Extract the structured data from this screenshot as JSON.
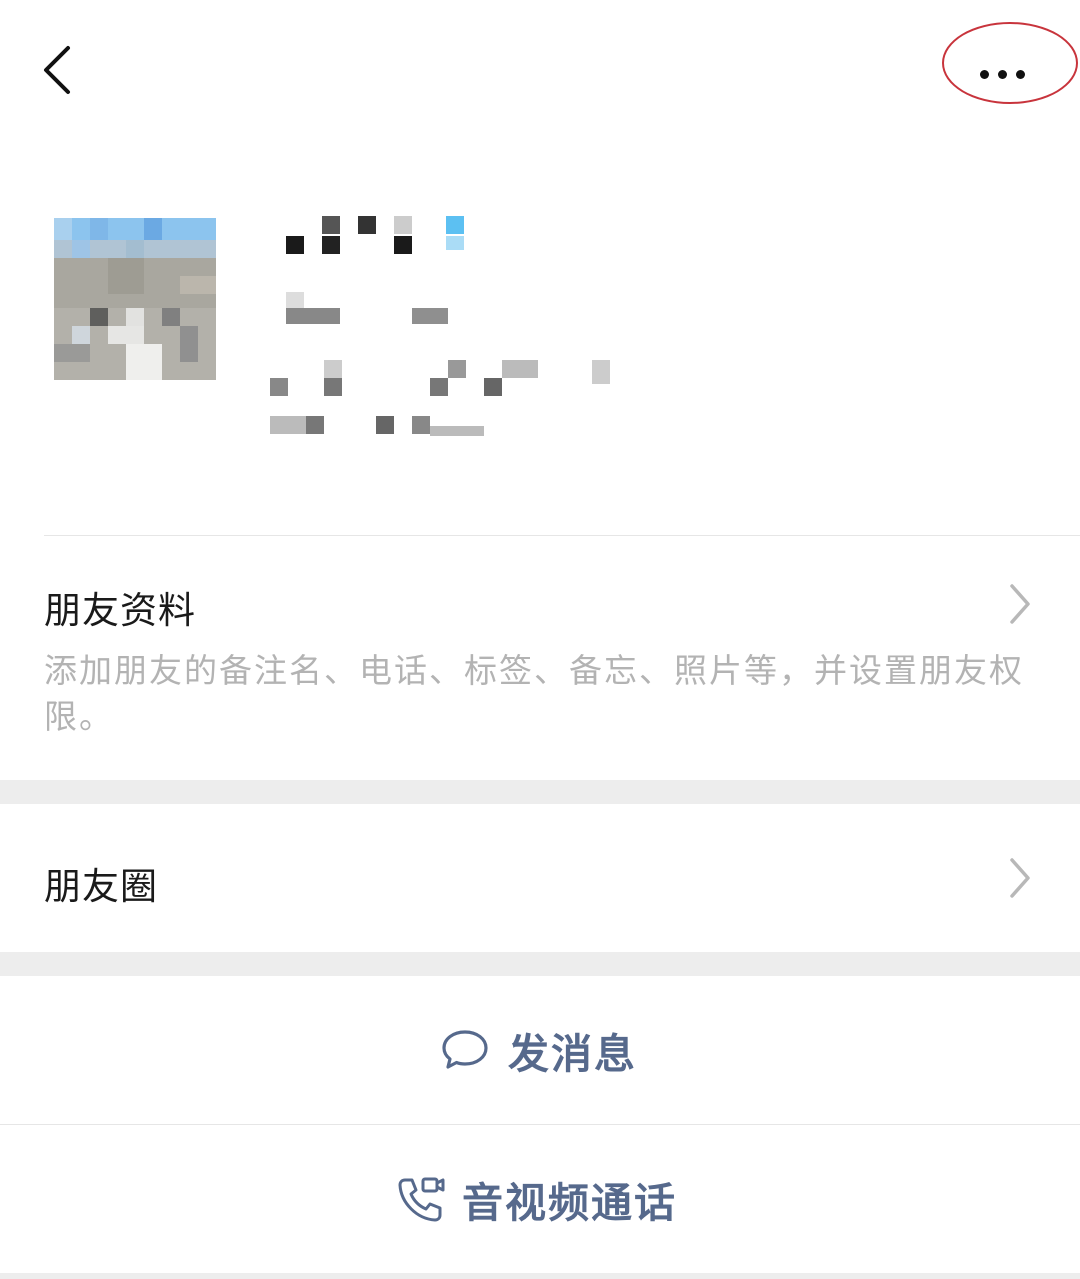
{
  "nav": {
    "back_icon": "chevron-left-icon",
    "more_icon": "more-dots-icon",
    "highlight_color": "#c8343c"
  },
  "profile": {
    "avatar": "pixelated-avatar",
    "name_text": "pixelated-name"
  },
  "friend_info": {
    "title": "朋友资料",
    "description": "添加朋友的备注名、电话、标签、备忘、照片等，并设置朋友权限。"
  },
  "moments": {
    "title": "朋友圈"
  },
  "actions": {
    "message_label": "发消息",
    "message_icon": "chat-bubble-icon",
    "call_label": "音视频通话",
    "call_icon": "phone-video-icon",
    "accent_color": "#56698c"
  }
}
